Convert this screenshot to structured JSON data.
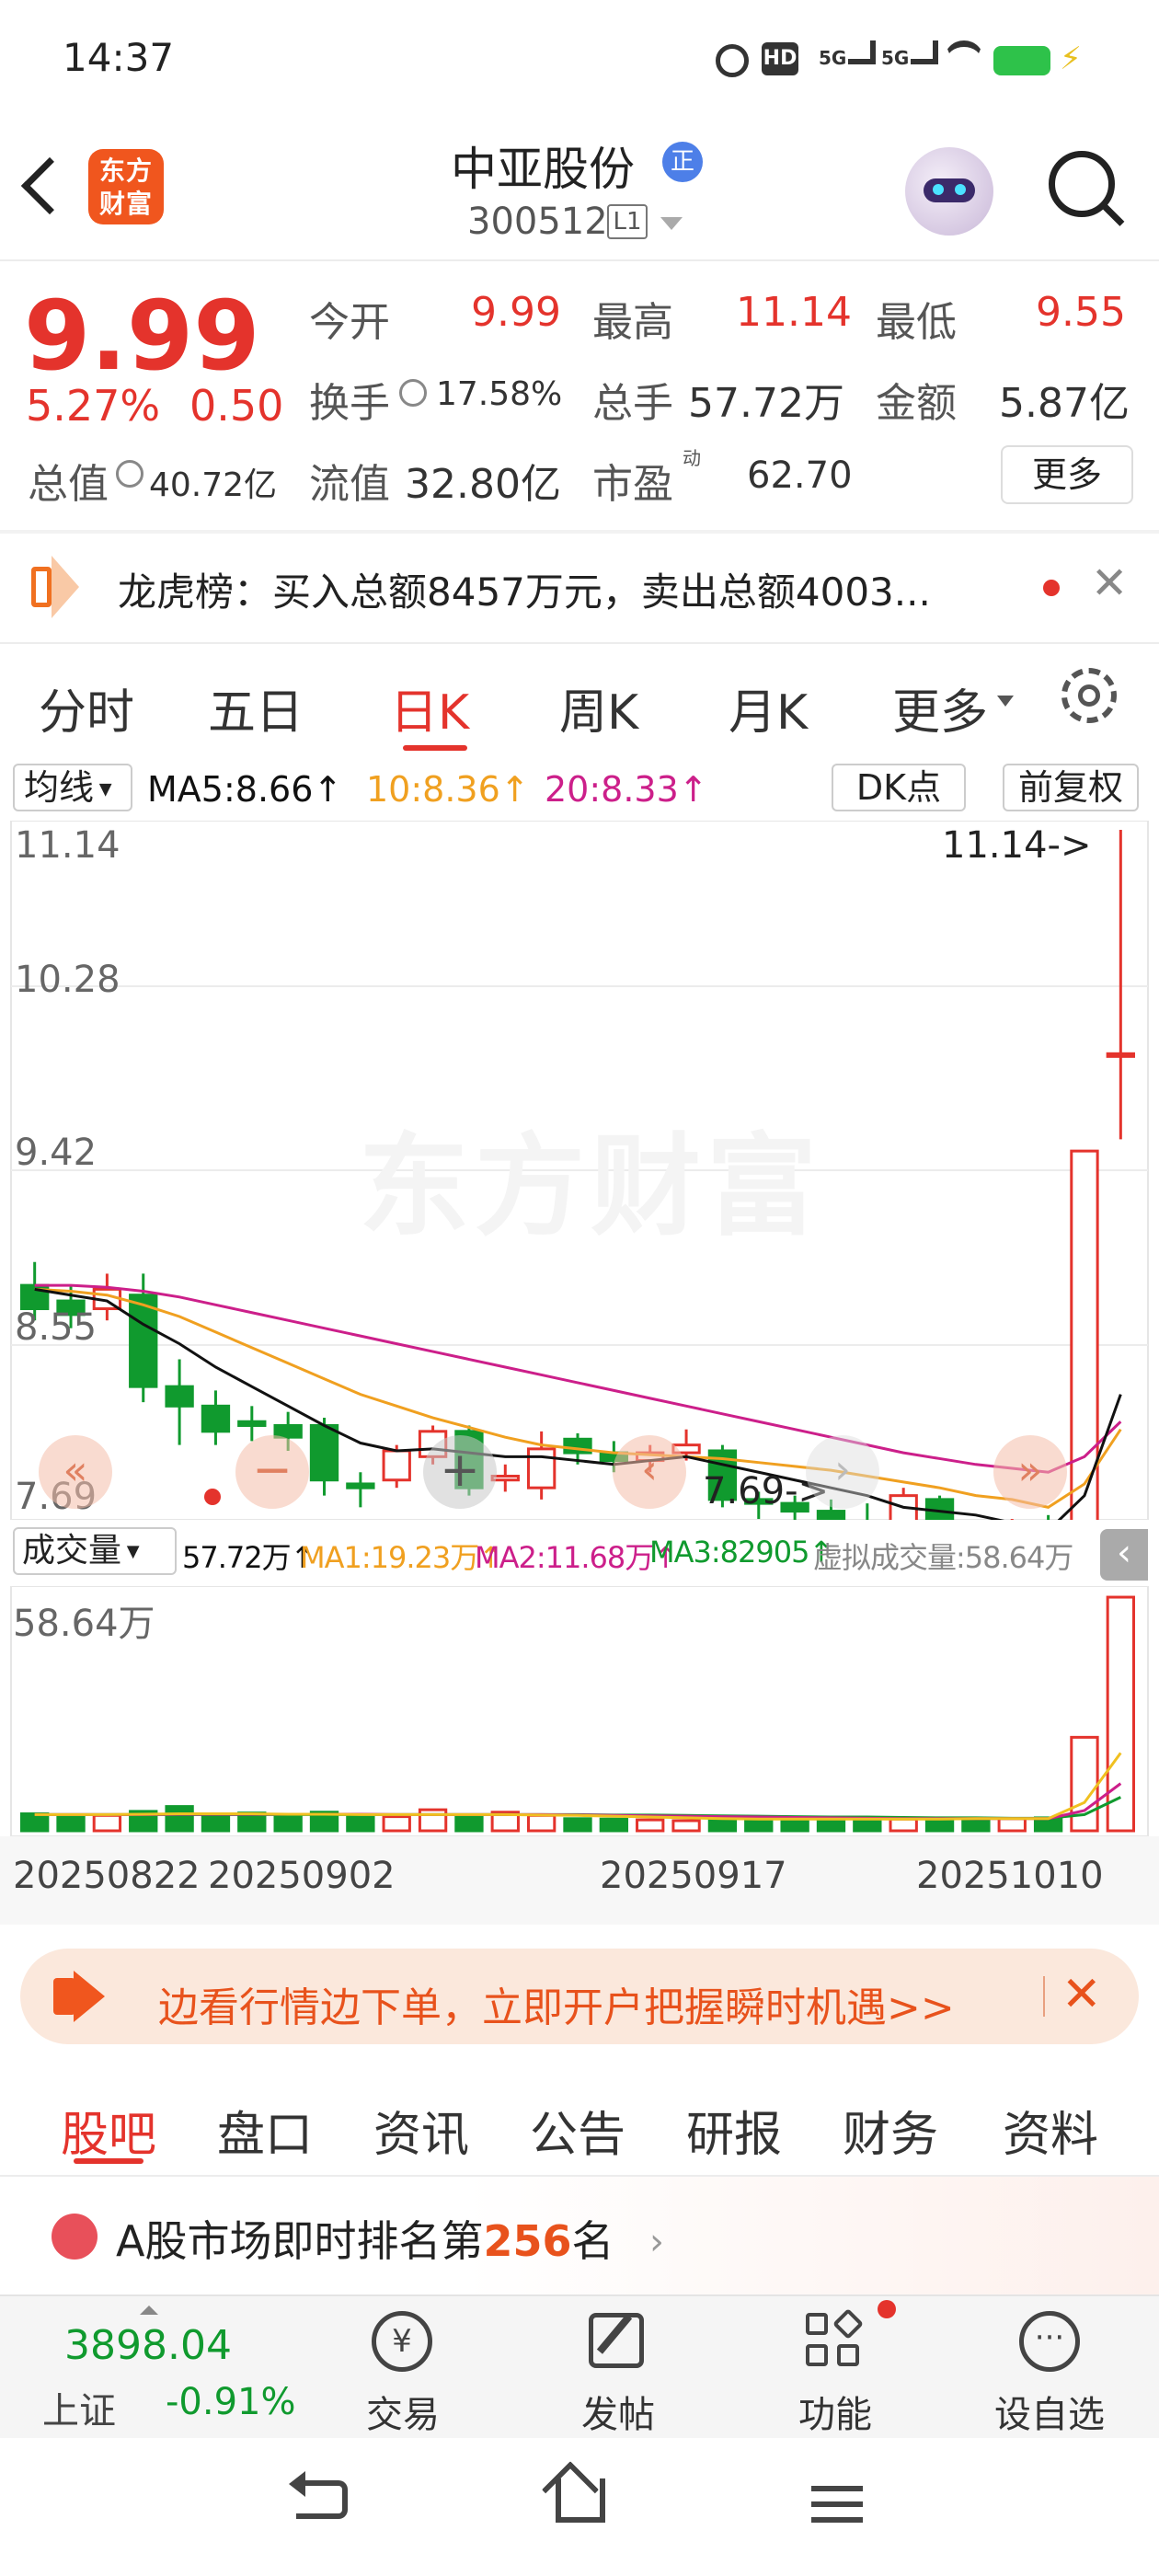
{
  "status_bar": {
    "time": "14:37"
  },
  "header": {
    "logo_text": "东方财富",
    "stock_name": "中亚股份",
    "badge": "正",
    "stock_code": "300512",
    "level": "L1"
  },
  "quote": {
    "price": "9.99",
    "change_pct": "5.27%",
    "change": "0.50",
    "open_label": "今开",
    "open": "9.99",
    "high_label": "最高",
    "high": "11.14",
    "low_label": "最低",
    "low": "9.55",
    "turnover_label": "换手",
    "turnover": "17.58%",
    "volume_label": "总手",
    "volume": "57.72万",
    "amount_label": "金额",
    "amount": "5.87亿",
    "mcap_label": "总值",
    "mcap": "40.72亿",
    "float_label": "流值",
    "float_mcap": "32.80亿",
    "pe_label": "市盈",
    "pe_sup": "动",
    "pe": "62.70",
    "more_button": "更多"
  },
  "notice": {
    "text": "龙虎榜：买入总额8457万元，卖出总额4003..."
  },
  "period_tabs": [
    "分时",
    "五日",
    "日K",
    "周K",
    "月K",
    "更多"
  ],
  "active_period": "日K",
  "chart_toolbar": {
    "indicator": "均线",
    "ma5": "MA5:8.66",
    "ma10": "10:8.36",
    "ma20": "20:8.33",
    "dk": "DK点",
    "adjust": "前复权"
  },
  "chart_labels": {
    "y1": "11.14",
    "y2": "10.28",
    "y3": "9.42",
    "y4": "8.55",
    "y5": "7.69",
    "high_marker": "11.14->",
    "low_marker": "7.69->",
    "watermark": "东方财富"
  },
  "volume_toolbar": {
    "indicator": "成交量",
    "vol": "57.72万",
    "ma1": "MA1:19.23万",
    "ma2": "MA2:11.68万",
    "ma3": "MA3:82905",
    "virtual": "虚拟成交量:58.64万",
    "ymax": "58.64万"
  },
  "x_dates": [
    "20250822",
    "20250902",
    "20250917",
    "20251010"
  ],
  "colors": {
    "up": "#e4332c",
    "down": "#109a2e",
    "ma5": "#111111",
    "ma10": "#f0a020",
    "ma20": "#cc1f8a"
  },
  "banner": {
    "text": "边看行情边下单，立即开户把握瞬时机遇>>"
  },
  "content_tabs": [
    "股吧",
    "盘口",
    "资讯",
    "公告",
    "研报",
    "财务",
    "资料"
  ],
  "active_content_tab": "股吧",
  "ranking": {
    "prefix": "A股市场即时排名第",
    "rank": "256",
    "suffix": "名"
  },
  "bottom_bar": {
    "index_value": "3898.04",
    "index_name": "上证",
    "index_change": "-0.91%",
    "items": [
      "交易",
      "发帖",
      "功能",
      "设自选"
    ]
  },
  "chart_data": {
    "type": "candlestick",
    "candles": [
      {
        "o": 8.8,
        "c": 8.68,
        "h": 8.92,
        "l": 8.62
      },
      {
        "o": 8.72,
        "c": 8.65,
        "h": 8.8,
        "l": 8.58
      },
      {
        "o": 8.68,
        "c": 8.78,
        "h": 8.86,
        "l": 8.62
      },
      {
        "o": 8.75,
        "c": 8.28,
        "h": 8.86,
        "l": 8.2
      },
      {
        "o": 8.28,
        "c": 8.18,
        "h": 8.42,
        "l": 7.98
      },
      {
        "o": 8.18,
        "c": 8.05,
        "h": 8.26,
        "l": 7.98
      },
      {
        "o": 8.1,
        "c": 8.08,
        "h": 8.18,
        "l": 8.0
      },
      {
        "o": 8.08,
        "c": 8.02,
        "h": 8.15,
        "l": 7.95
      },
      {
        "o": 8.08,
        "c": 7.8,
        "h": 8.12,
        "l": 7.72
      },
      {
        "o": 7.78,
        "c": 7.76,
        "h": 7.84,
        "l": 7.66
      },
      {
        "o": 7.8,
        "c": 7.95,
        "h": 7.98,
        "l": 7.76
      },
      {
        "o": 7.92,
        "c": 8.05,
        "h": 8.08,
        "l": 7.88
      },
      {
        "o": 8.05,
        "c": 7.76,
        "h": 8.08,
        "l": 7.72
      },
      {
        "o": 7.8,
        "c": 7.82,
        "h": 7.88,
        "l": 7.74
      },
      {
        "o": 7.76,
        "c": 7.96,
        "h": 8.05,
        "l": 7.7
      },
      {
        "o": 8.01,
        "c": 7.94,
        "h": 8.04,
        "l": 7.88
      },
      {
        "o": 7.94,
        "c": 7.9,
        "h": 8.0,
        "l": 7.84
      },
      {
        "o": 7.9,
        "c": 7.94,
        "h": 7.98,
        "l": 7.84
      },
      {
        "o": 7.94,
        "c": 7.98,
        "h": 8.06,
        "l": 7.9
      },
      {
        "o": 7.95,
        "c": 7.7,
        "h": 7.98,
        "l": 7.66
      },
      {
        "o": 7.7,
        "c": 7.68,
        "h": 7.74,
        "l": 7.6
      },
      {
        "o": 7.68,
        "c": 7.64,
        "h": 7.72,
        "l": 7.56
      },
      {
        "o": 7.64,
        "c": 7.58,
        "h": 7.7,
        "l": 7.54
      },
      {
        "o": 7.58,
        "c": 7.55,
        "h": 7.68,
        "l": 7.25
      },
      {
        "o": 7.58,
        "c": 7.72,
        "h": 7.76,
        "l": 7.46
      },
      {
        "o": 7.7,
        "c": 7.49,
        "h": 7.72,
        "l": 7.41
      },
      {
        "o": 7.47,
        "c": 7.44,
        "h": 7.52,
        "l": 7.36
      },
      {
        "o": 7.42,
        "c": 7.58,
        "h": 7.6,
        "l": 7.34
      },
      {
        "o": 7.54,
        "c": 7.42,
        "h": 7.62,
        "l": 7.39
      },
      {
        "o": 7.49,
        "c": 9.49,
        "h": 9.49,
        "l": 7.46
      },
      {
        "o": 9.99,
        "c": 9.99,
        "h": 11.14,
        "l": 9.55
      }
    ],
    "ma5": [
      8.78,
      8.75,
      8.72,
      8.6,
      8.5,
      8.38,
      8.28,
      8.18,
      8.08,
      7.99,
      7.95,
      7.96,
      7.94,
      7.92,
      7.92,
      7.9,
      7.88,
      7.9,
      7.92,
      7.88,
      7.84,
      7.8,
      7.76,
      7.72,
      7.66,
      7.64,
      7.62,
      7.58,
      7.54,
      7.72,
      8.24
    ],
    "ma10": [
      8.78,
      8.77,
      8.75,
      8.7,
      8.64,
      8.56,
      8.48,
      8.4,
      8.32,
      8.24,
      8.18,
      8.12,
      8.07,
      8.02,
      7.98,
      7.96,
      7.94,
      7.93,
      7.92,
      7.91,
      7.89,
      7.87,
      7.85,
      7.82,
      7.79,
      7.76,
      7.72,
      7.7,
      7.66,
      7.78,
      8.06
    ],
    "ma20": [
      8.8,
      8.8,
      8.79,
      8.77,
      8.74,
      8.7,
      8.66,
      8.62,
      8.58,
      8.54,
      8.5,
      8.46,
      8.42,
      8.38,
      8.34,
      8.3,
      8.26,
      8.22,
      8.18,
      8.14,
      8.1,
      8.06,
      8.02,
      7.98,
      7.94,
      7.91,
      7.88,
      7.86,
      7.84,
      7.92,
      8.1
    ],
    "volume_wan": [
      4.2,
      3.6,
      3.8,
      4.8,
      6.0,
      3.8,
      4.4,
      3.9,
      4.6,
      3.5,
      3.5,
      5.2,
      3.8,
      4.6,
      3.8,
      3.0,
      2.9,
      2.7,
      2.5,
      2.8,
      2.9,
      3.0,
      3.3,
      3.1,
      2.9,
      2.8,
      2.7,
      3.0,
      3.2,
      23.1,
      57.72
    ],
    "vol_ma1": [
      4.0,
      4.0,
      4.0,
      4.1,
      4.2,
      4.2,
      4.2,
      4.1,
      4.1,
      4.0,
      4.0,
      4.0,
      4.0,
      4.0,
      3.9,
      3.8,
      3.6,
      3.4,
      3.2,
      3.0,
      2.9,
      2.9,
      2.9,
      2.9,
      2.9,
      2.9,
      3.0,
      3.0,
      3.0,
      7.0,
      19.23
    ],
    "vol_ma2": [
      4.0,
      4.0,
      4.0,
      4.0,
      4.1,
      4.1,
      4.1,
      4.1,
      4.1,
      4.1,
      4.0,
      4.0,
      4.0,
      4.0,
      4.0,
      3.9,
      3.8,
      3.7,
      3.6,
      3.5,
      3.4,
      3.3,
      3.2,
      3.1,
      3.0,
      3.0,
      3.0,
      3.0,
      3.0,
      5.0,
      11.68
    ],
    "vol_ma3": [
      4.0,
      4.0,
      4.0,
      4.0,
      4.0,
      4.0,
      4.0,
      4.0,
      4.0,
      4.0,
      4.0,
      4.0,
      4.0,
      4.0,
      4.0,
      4.0,
      3.9,
      3.9,
      3.8,
      3.7,
      3.6,
      3.5,
      3.4,
      3.4,
      3.3,
      3.2,
      3.2,
      3.1,
      3.1,
      4.0,
      8.29
    ],
    "ylim": [
      7.69,
      11.14
    ],
    "vol_max_wan": 58.64
  }
}
